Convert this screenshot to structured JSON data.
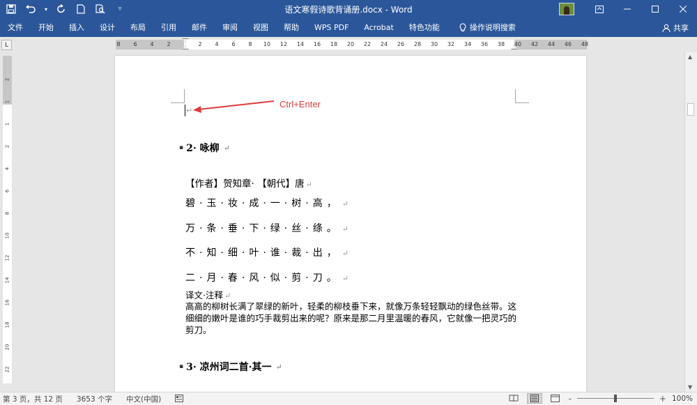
{
  "window": {
    "title": "语文寒假诗歌背诵册.docx - Word"
  },
  "ribbon": {
    "tabs": [
      "文件",
      "开始",
      "插入",
      "设计",
      "布局",
      "引用",
      "邮件",
      "审阅",
      "视图",
      "帮助",
      "WPS PDF",
      "Acrobat",
      "特色功能"
    ],
    "tell_me": "操作说明搜索",
    "share": "共享"
  },
  "ruler": {
    "tab_selector": "L",
    "left_ticks": [
      "8",
      "6",
      "4",
      "2"
    ],
    "right_ticks": [
      "2",
      "4",
      "6",
      "8",
      "10",
      "12",
      "14",
      "16",
      "18",
      "20",
      "22",
      "24",
      "26",
      "28",
      "30",
      "32",
      "34",
      "36",
      "38",
      "40",
      "42",
      "44",
      "46",
      "48"
    ],
    "vertical_ticks": [
      "2",
      "1",
      "1",
      "2",
      "4",
      "6",
      "8",
      "10",
      "12",
      "14",
      "16",
      "18",
      "20",
      "22"
    ]
  },
  "annotation": {
    "label": "Ctrl+Enter",
    "color": "#e03b3b"
  },
  "document": {
    "paragraph_mark": "↵",
    "heading1": "2· 咏柳",
    "author_line": "【作者】贺知章· 【朝代】唐",
    "poem_lines": [
      "碧·玉·妆·成·一·树·高，",
      "万·条·垂·下·绿·丝·绦。",
      "不·知·细·叶·谁·裁·出，",
      "二·月·春·风·似·剪·刀。"
    ],
    "translation_title": "译文·注释",
    "translation_body": "高高的柳树长满了翠绿的新叶，轻柔的柳枝垂下来，就像万条轻轻飘动的绿色丝带。这细细的嫩叶是谁的巧手裁剪出来的呢？原来是那二月里温暖的春风，它就像一把灵巧的剪刀。",
    "heading2": "3· 凉州词二首·其一"
  },
  "statusbar": {
    "page_info": "第 3 页，共 12 页",
    "word_count": "3653 个字",
    "language": "中文(中国)",
    "zoom_minus": "-",
    "zoom_plus": "+",
    "zoom_level": "100%",
    "zoom_fraction": 0.5
  },
  "colors": {
    "brand": "#2b579a",
    "annotation": "#e03b3b"
  }
}
